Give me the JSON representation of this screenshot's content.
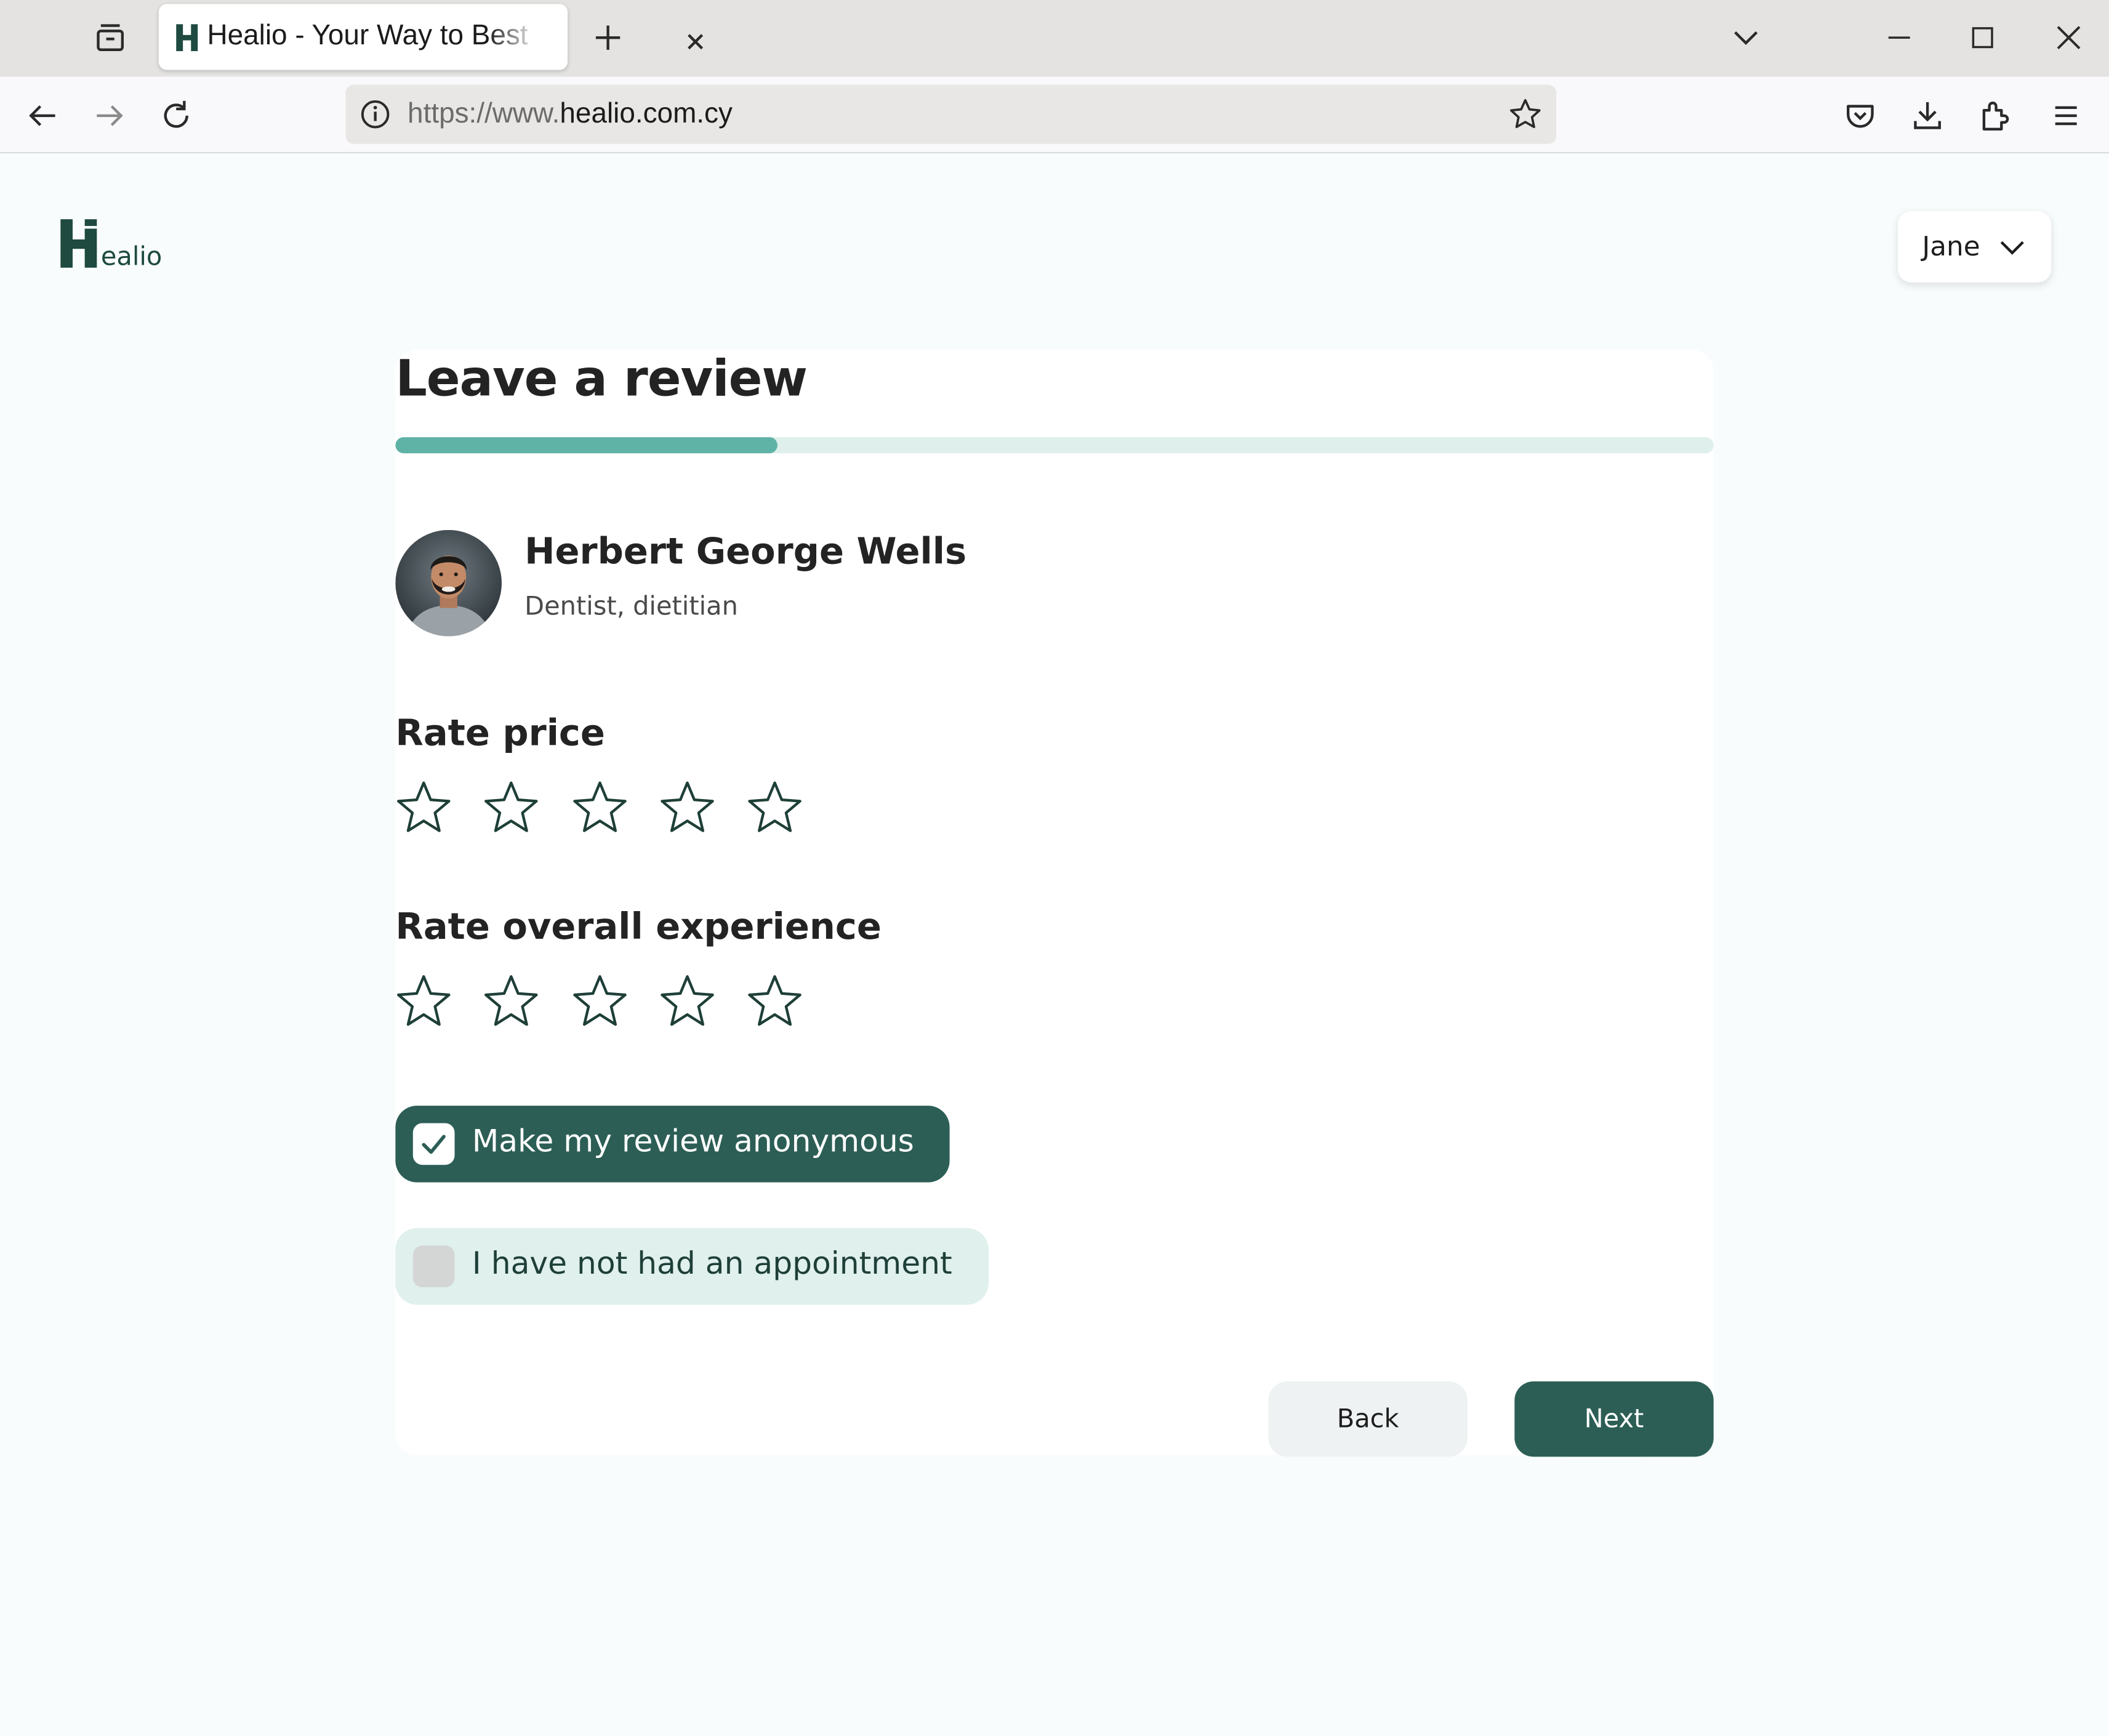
{
  "browser": {
    "tab_title": "Healio - Your Way to Best",
    "url_prefix": "https://www.",
    "url_domain": "healio.com.cy"
  },
  "header": {
    "logo_text": "ealio",
    "user_name": "Jane"
  },
  "review": {
    "title": "Leave a review",
    "progress": 0.29,
    "doctor": {
      "name": "Herbert George Wells",
      "specialty": "Dentist, dietitian"
    },
    "rate_price": {
      "label": "Rate price",
      "rating": 0,
      "max": 5
    },
    "rate_experience": {
      "label": "Rate overall experience",
      "rating": 0,
      "max": 5
    },
    "anonymous": {
      "label": "Make my review anonymous",
      "checked": true
    },
    "no_appointment": {
      "label": "I have not had an appointment",
      "checked": false
    },
    "back_label": "Back",
    "next_label": "Next"
  },
  "colors": {
    "brand_dark": "#2c5e55",
    "progress": "#5fb2a6",
    "progress_track": "#dfefec",
    "pill_light": "#e0f0ed"
  }
}
